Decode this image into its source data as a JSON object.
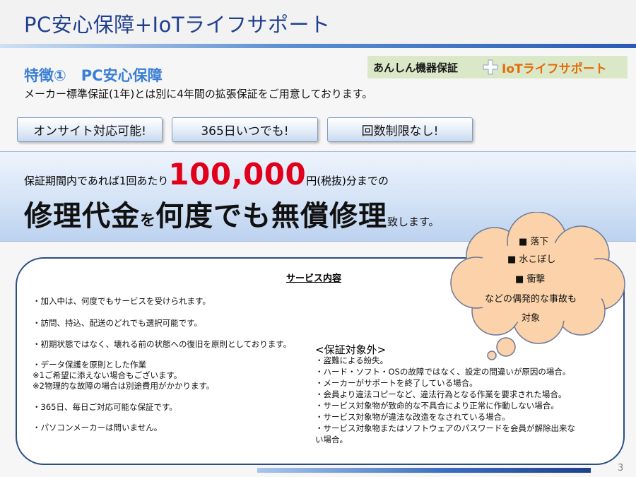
{
  "header": {
    "title": "PC安心保障+IoTライフサポート"
  },
  "feature": {
    "title": "特徴①　PC安心保障",
    "description": "メーカー標準保証(1年)とは別に4年間の拡張保証をご用意しております。"
  },
  "logo": {
    "left_text": "あんしん機器保証",
    "right_text": "IoTライフサポート"
  },
  "pills": [
    "オンサイト対応可能!",
    "365日いつでも!",
    "回数制限なし!"
  ],
  "banner": {
    "line1_pre": "保証期間内であれば1回あたり",
    "amount": "100,000",
    "line1_post": "円(税抜)分までの",
    "line2_part1": "修理代金",
    "line2_part2": "を",
    "line2_part3": "何度でも無償修理",
    "line2_part4": "致します。"
  },
  "cloud": {
    "items": [
      "■ 落下",
      "■ 水こぼし",
      "■ 衝撃",
      "などの偶発的な事故も",
      "対象"
    ]
  },
  "service": {
    "heading": "サービス内容",
    "items": [
      "・加入中は、何度でもサービスを受けられます。",
      "・訪問、持込、配送のどれでも選択可能です。",
      "・初期状態ではなく、壊れる前の状態への復旧を原則としております。",
      "・データ保護を原則とした作業",
      "※1ご希望に添えない場合もございます。",
      "※2物理的な故障の場合は別途費用がかかります。",
      "・365日、毎日ご対応可能な保証です。",
      "・パソコンメーカーは問いません。"
    ],
    "exclusions_title": "<保証対象外>",
    "exclusions": [
      "・盗難による紛失。",
      "・ハード・ソフト・OSの故障ではなく、設定の間違いが原因の場合。",
      "・メーカーがサポートを終了している場合。",
      "・会員より違法コピーなど、違法行為となる作業を要求された場合。",
      "・サービス対象物が致命的な不具合により正常に作動しない場合。",
      "・サービス対象物が違法な改造をなされている場合。",
      "・サービス対象物またはソフトウェアのパスワードを会員が解除出来な",
      "い場合。"
    ]
  },
  "footer": {
    "page_number": "3"
  },
  "colors": {
    "title": "#1f3f8f",
    "feature_title": "#3a7fd5",
    "amount": "#e0001b",
    "cloud_fill": "#fbd2a9",
    "logo_orange": "#e46c0a"
  }
}
